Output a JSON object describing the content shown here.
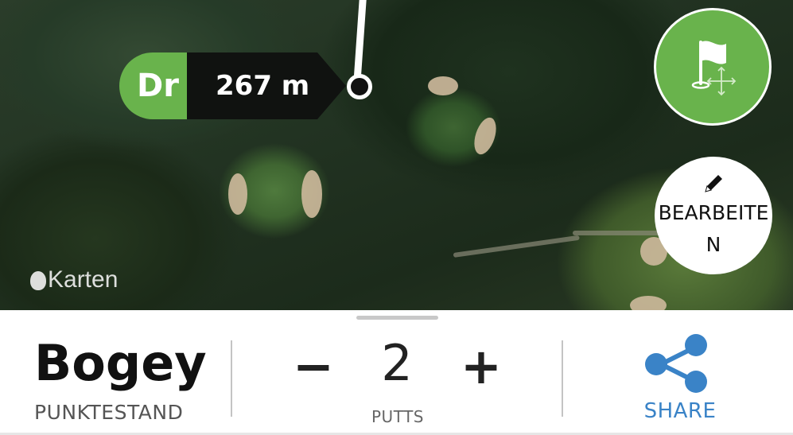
{
  "map": {
    "brand_label": "Karten",
    "distance_marker": {
      "club": "Dr",
      "distance": "267 m"
    },
    "flag_button_icon": "flag-move-icon",
    "edit_button": {
      "label": "BEARBEITEN",
      "icon": "pencil-icon"
    }
  },
  "score": {
    "value": "Bogey",
    "label": "PUNKTESTAND"
  },
  "putts": {
    "minus": "−",
    "value": "2",
    "plus": "+",
    "label": "PUTTS"
  },
  "share": {
    "label": "SHARE",
    "icon": "share-icon"
  },
  "colors": {
    "green": "#69b34c",
    "share_blue": "#3a83c7"
  }
}
